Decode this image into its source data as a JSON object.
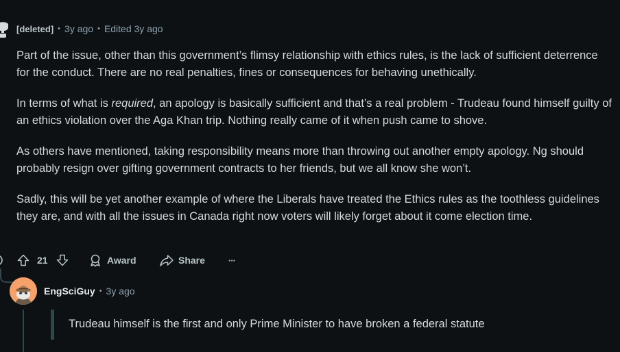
{
  "comment1": {
    "author": "[deleted]",
    "age": "3y ago",
    "edited": "Edited 3y ago",
    "paragraphs": [
      {
        "text": "Part of the issue, other than this government’s flimsy relationship with ethics rules, is the lack of sufficient deterrence for the conduct. There are no real penalties, fines or consequences for behaving unethically."
      },
      {
        "before": "In terms of what is ",
        "emph": "required",
        "after": ", an apology is basically sufficient and that’s a real problem - Trudeau found himself guilty of an ethics violation over the Aga Khan trip. Nothing really came of it when push came to shove."
      },
      {
        "text": "As others have mentioned, taking responsibility means more than throwing out another empty apology. Ng should probably resign over gifting government contracts to her friends, but we all know she won’t."
      },
      {
        "text": "Sadly, this will be yet another example of where the Liberals have treated the Ethics rules as the toothless guidelines they are, and with all the issues in Canada right now voters will likely forget about it come election time."
      }
    ],
    "actions": {
      "votes": "21",
      "award_label": "Award",
      "share_label": "Share",
      "more_label": "···"
    }
  },
  "reply": {
    "author": "EngSciGuy",
    "age": "3y ago",
    "quote": "Trudeau himself is the first and only Prime Minister to have broken a federal statute"
  },
  "colors": {
    "background": "#0e1113",
    "text": "#d7dadc",
    "meta": "#8ba2ad",
    "avatar": "#f6a06a"
  }
}
